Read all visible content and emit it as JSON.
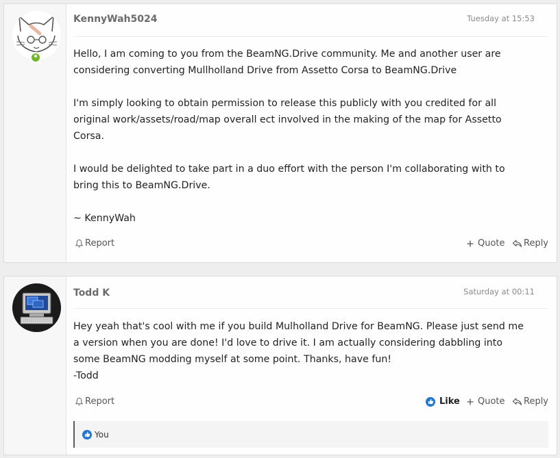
{
  "posts": [
    {
      "username": "KennyWah5024",
      "timestamp": "Tuesday at 15:53",
      "avatar": "cat-sketch-avatar",
      "online": true,
      "paragraphs": [
        "Hello, I am coming to you from the BeamNG.Drive community. Me and another user are\nconsidering converting Mullholland Drive from Assetto Corsa to BeamNG.Drive",
        "I'm simply looking to obtain permission to release this publicly with you credited for all\noriginal work/assets/road/map overall ect involved in the making of the map for Assetto\nCorsa.",
        "I would be delighted to take part in a duo effort with the person I'm collaborating with to\nbring this to BeamNG.Drive.",
        "~ KennyWah"
      ],
      "actions": {
        "report": "Report",
        "quote": "Quote",
        "reply": "Reply"
      }
    },
    {
      "username": "Todd K",
      "timestamp": "Saturday at 00:11",
      "avatar": "retro-computer-avatar",
      "paragraphs": [
        "Hey yeah that's cool with me if you build Mulholland Drive for BeamNG. Please just send me\na version when you are done! I'd love to drive it. I am actually considering dabbling into\nsome BeamNG modding myself at some point. Thanks, have fun!\n-Todd"
      ],
      "actions": {
        "report": "Report",
        "like": "Like",
        "quote": "Quote",
        "reply": "Reply"
      },
      "likes": "You"
    }
  ],
  "colors": {
    "accent": "#2577d1",
    "online": "#6fb82a",
    "username": "#6b6b6b"
  },
  "icons": [
    "bell-icon",
    "plus-icon",
    "reply-icon",
    "thumbs-up-icon"
  ]
}
